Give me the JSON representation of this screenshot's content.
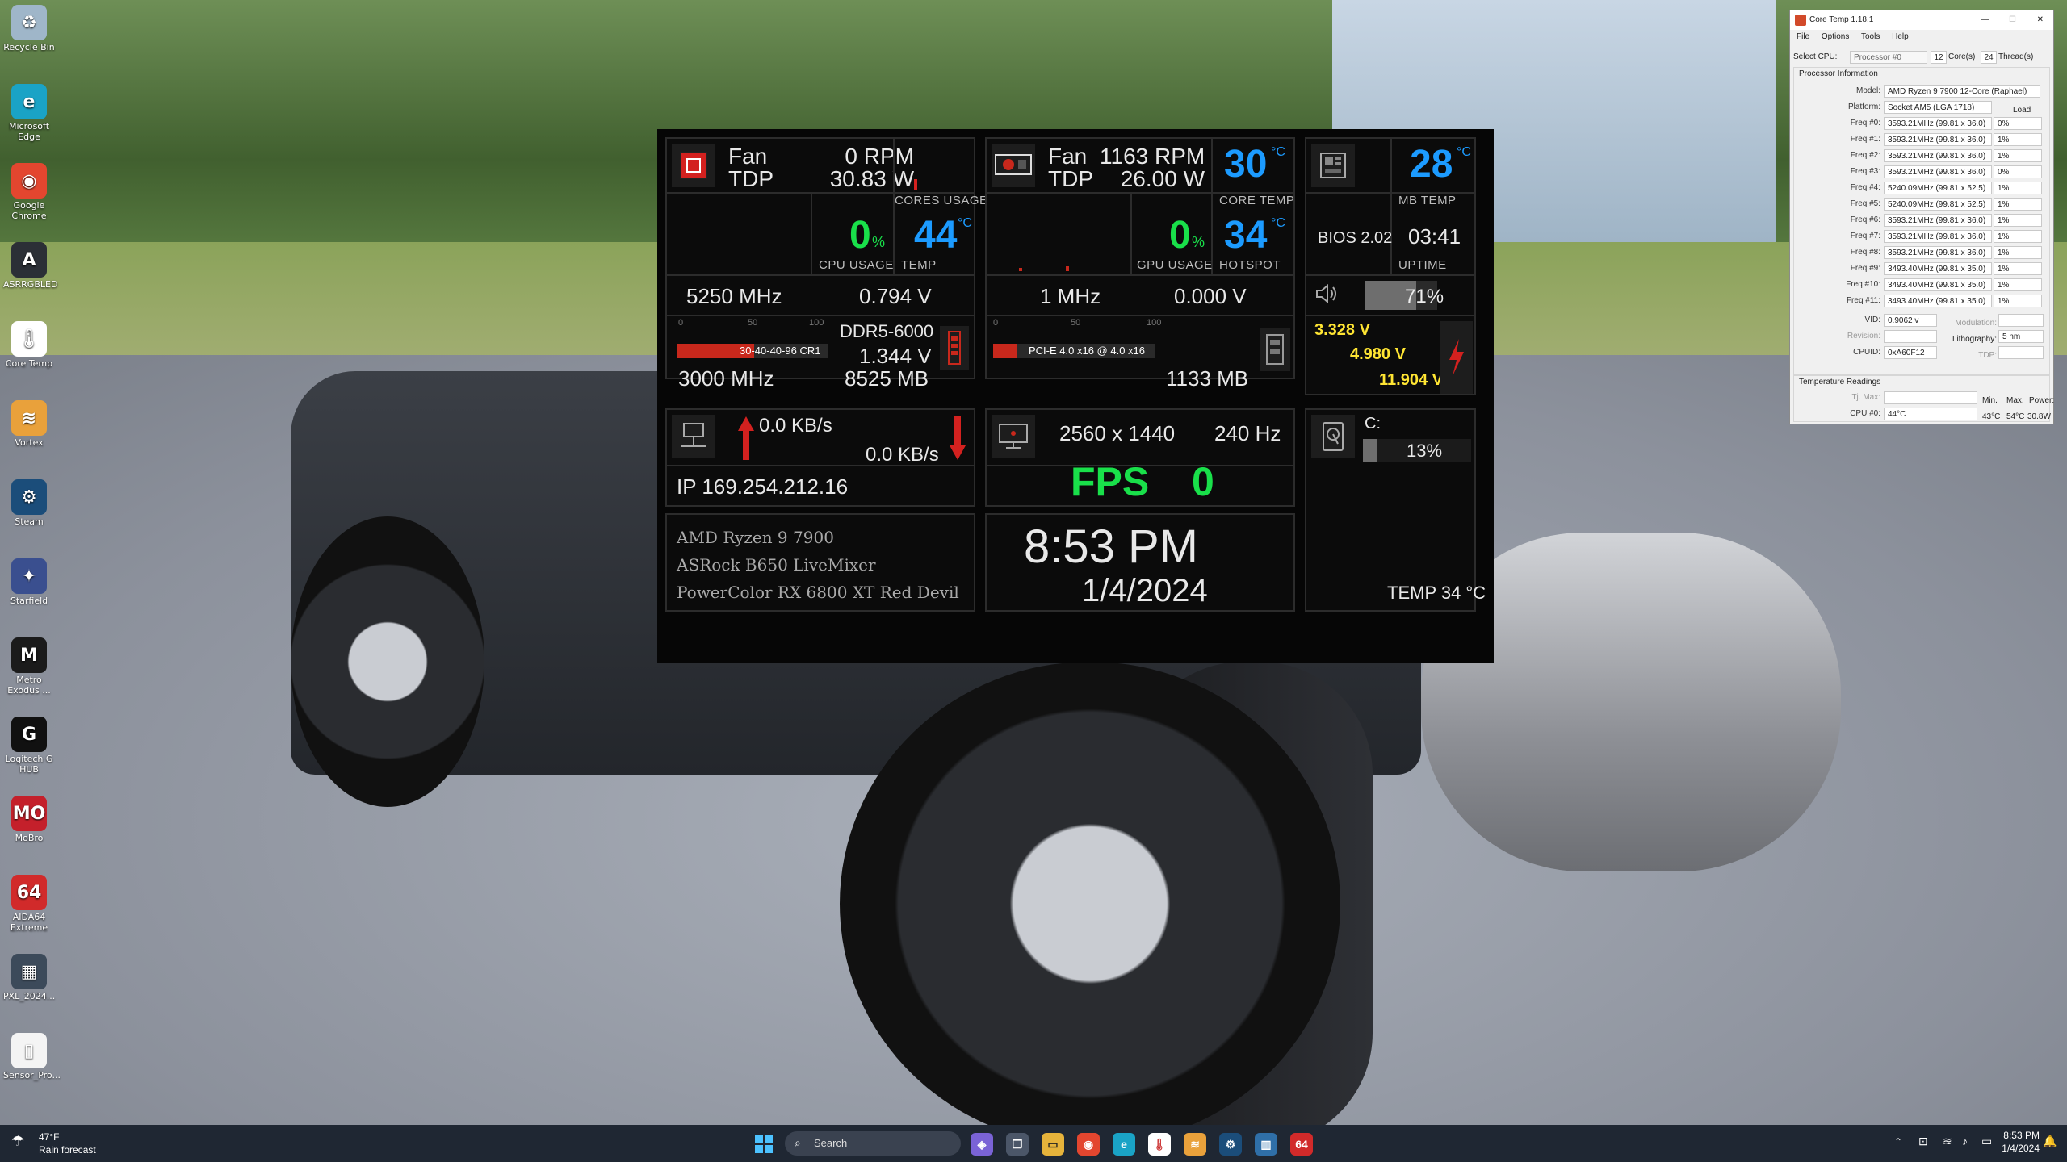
{
  "desktop": {
    "icons": [
      {
        "label": "Recycle Bin",
        "icon": "recycle-bin-icon",
        "glyph": "♻",
        "color": "#9fb6c9"
      },
      {
        "label": "Microsoft Edge",
        "icon": "edge-icon",
        "glyph": "e",
        "color": "#1aa3c6"
      },
      {
        "label": "Google Chrome",
        "icon": "chrome-icon",
        "glyph": "◉",
        "color": "#e3462f"
      },
      {
        "label": "ASRRGBLED",
        "icon": "asrock-icon",
        "glyph": "A",
        "color": "#2b2f36"
      },
      {
        "label": "Core Temp",
        "icon": "core-temp-icon",
        "glyph": "🌡",
        "color": "#ffffff"
      },
      {
        "label": "Vortex",
        "icon": "vortex-icon",
        "glyph": "≋",
        "color": "#e9a13b"
      },
      {
        "label": "Steam",
        "icon": "steam-icon",
        "glyph": "⚙",
        "color": "#1b4d7a"
      },
      {
        "label": "Starfield",
        "icon": "starfield-icon",
        "glyph": "✦",
        "color": "#3a4f8f"
      },
      {
        "label": "Metro Exodus ...",
        "icon": "metro-icon",
        "glyph": "M",
        "color": "#1b1b1b"
      },
      {
        "label": "Logitech G HUB",
        "icon": "logitech-icon",
        "glyph": "G",
        "color": "#111111"
      },
      {
        "label": "MoBro",
        "icon": "mobro-icon",
        "glyph": "MO",
        "color": "#c4202b"
      },
      {
        "label": "AIDA64 Extreme",
        "icon": "aida64-icon",
        "glyph": "64",
        "color": "#d12a2a"
      },
      {
        "label": "PXL_2024...",
        "icon": "photo-file-icon",
        "glyph": "▦",
        "color": "#3c4a5a"
      },
      {
        "label": "Sensor_Pro...",
        "icon": "file-icon",
        "glyph": "▯",
        "color": "#f4f4f4"
      }
    ]
  },
  "widget": {
    "cpu": {
      "fan_label": "Fan",
      "fan_value": "0 RPM",
      "tdp_label": "TDP",
      "tdp_value": "30.83 W",
      "cores_usage_label": "CORES USAGE",
      "usage_value": "0",
      "usage_unit": "%",
      "usage_label": "CPU USAGE",
      "temp_value": "44",
      "temp_unit": "°C",
      "temp_label": "TEMP",
      "clock": "5250 MHz",
      "voltage": "0.794 V"
    },
    "gpu": {
      "fan_label": "Fan",
      "fan_value": "1163 RPM",
      "tdp_label": "TDP",
      "tdp_value": "26.00 W",
      "core_temp_value": "30",
      "core_temp_unit": "°C",
      "core_temp_label": "CORE TEMP",
      "usage_value": "0",
      "usage_unit": "%",
      "usage_label": "GPU USAGE",
      "hotspot_value": "34",
      "hotspot_unit": "°C",
      "hotspot_label": "HOTSPOT",
      "clock": "1 MHz",
      "voltage": "0.000 V",
      "bus": "PCI-E 4.0 x16 @ 4.0 x16",
      "vram": "1133 MB",
      "scale": [
        "0",
        "50",
        "100"
      ]
    },
    "mb": {
      "temp_value": "28",
      "temp_unit": "°C",
      "temp_label": "MB TEMP",
      "bios": "BIOS 2.02",
      "uptime": "03:41",
      "uptime_label": "UPTIME",
      "volume": "71%",
      "volume_fraction": 0.71,
      "rail_3v": "3.328 V",
      "rail_5v": "4.980 V",
      "rail_12v": "11.904 V"
    },
    "ram": {
      "type": "DDR5-6000",
      "timings": "30-40-40-96 CR1",
      "voltage": "1.344 V",
      "clock": "3000 MHz",
      "used": "8525 MB",
      "scale": [
        "0",
        "50",
        "100"
      ],
      "load_fraction": 0.51
    },
    "net": {
      "upload": "0.0 KB/s",
      "download": "0.0 KB/s",
      "ip": "IP 169.254.212.16"
    },
    "display": {
      "resolution": "2560 x 1440",
      "refresh": "240 Hz",
      "fps_label": "FPS",
      "fps_value": "0"
    },
    "drive": {
      "letter": "C:",
      "usage": "13%",
      "usage_fraction": 0.13,
      "temp": "TEMP 34 °C"
    },
    "system": {
      "cpu_name": "AMD Ryzen 9 7900",
      "board_name": "ASRock B650 LiveMixer",
      "gpu_name": "PowerColor RX 6800 XT Red Devil"
    },
    "clock": {
      "time": "8:53 PM",
      "date": "1/4/2024"
    }
  },
  "coretemp": {
    "title": "Core Temp 1.18.1",
    "menu": [
      "File",
      "Options",
      "Tools",
      "Help"
    ],
    "select_cpu_label": "Select CPU:",
    "processor": "Processor #0",
    "cores_value": "12",
    "cores_label": "Core(s)",
    "threads_value": "24",
    "threads_label": "Thread(s)",
    "proc_info_label": "Processor Information",
    "model_label": "Model:",
    "model": "AMD Ryzen 9 7900 12-Core (Raphael)",
    "platform_label": "Platform:",
    "platform": "Socket AM5 (LGA 1718)",
    "load_label": "Load",
    "freqs": [
      {
        "label": "Freq #0:",
        "value": "3593.21MHz (99.81 x 36.0)",
        "load": "0%"
      },
      {
        "label": "Freq #1:",
        "value": "3593.21MHz (99.81 x 36.0)",
        "load": "1%"
      },
      {
        "label": "Freq #2:",
        "value": "3593.21MHz (99.81 x 36.0)",
        "load": "1%"
      },
      {
        "label": "Freq #3:",
        "value": "3593.21MHz (99.81 x 36.0)",
        "load": "0%"
      },
      {
        "label": "Freq #4:",
        "value": "5240.09MHz (99.81 x 52.5)",
        "load": "1%"
      },
      {
        "label": "Freq #5:",
        "value": "5240.09MHz (99.81 x 52.5)",
        "load": "1%"
      },
      {
        "label": "Freq #6:",
        "value": "3593.21MHz (99.81 x 36.0)",
        "load": "1%"
      },
      {
        "label": "Freq #7:",
        "value": "3593.21MHz (99.81 x 36.0)",
        "load": "1%"
      },
      {
        "label": "Freq #8:",
        "value": "3593.21MHz (99.81 x 36.0)",
        "load": "1%"
      },
      {
        "label": "Freq #9:",
        "value": "3493.40MHz (99.81 x 35.0)",
        "load": "1%"
      },
      {
        "label": "Freq #10:",
        "value": "3493.40MHz (99.81 x 35.0)",
        "load": "1%"
      },
      {
        "label": "Freq #11:",
        "value": "3493.40MHz (99.81 x 35.0)",
        "load": "1%"
      }
    ],
    "vid_label": "VID:",
    "vid": "0.9062 v",
    "modulation_label": "Modulation:",
    "revision_label": "Revision:",
    "lithography_label": "Lithography:",
    "lithography": "5 nm",
    "cpuid_label": "CPUID:",
    "cpuid": "0xA60F12",
    "tdp_label": "TDP:",
    "temp_readings_label": "Temperature Readings",
    "tjmax_label": "Tj. Max:",
    "min_label": "Min.",
    "max_label": "Max.",
    "power_label": "Power:",
    "cpu0_label": "CPU #0:",
    "cpu0_temp": "44°C",
    "cpu0_min": "43°C",
    "cpu0_max": "54°C",
    "cpu0_power": "30.8W"
  },
  "taskbar": {
    "weather_temp": "47°F",
    "weather_desc": "Rain forecast",
    "search_placeholder": "Search",
    "time": "8:53 PM",
    "date": "1/4/2024"
  }
}
